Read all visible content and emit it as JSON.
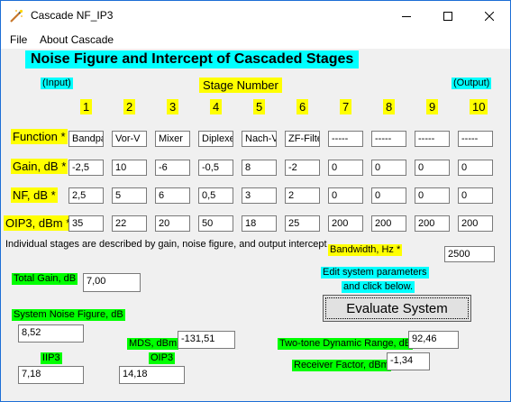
{
  "window": {
    "title": "Cascade NF_IP3"
  },
  "menu": {
    "file": "File",
    "about": "About Cascade"
  },
  "heading": "Noise Figure and Intercept of Cascaded Stages",
  "labels": {
    "input": "(Input)",
    "output": "(Output)",
    "stage_number": "Stage Number",
    "function": "Function *",
    "gain": "Gain, dB *",
    "nf": "NF, dB *",
    "oip3": "OIP3, dBm *",
    "description": "Individual stages are described by gain, noise figure, and output intercept .",
    "bandwidth": "Bandwidth, Hz *",
    "edit_line1": "Edit system parameters",
    "edit_line2": "and click below.",
    "total_gain": "Total Gain, dB",
    "system_nf": "System Noise Figure, dB",
    "mds": "MDS, dBm",
    "iip3": "IIP3",
    "oip3_result": "OIP3",
    "two_tone": "Two-tone Dynamic Range, dB",
    "receiver_factor": "Receiver Factor, dBm"
  },
  "stages": [
    "1",
    "2",
    "3",
    "4",
    "5",
    "6",
    "7",
    "8",
    "9",
    "10"
  ],
  "functions": [
    "Bandpa",
    "Vor-V",
    "Mixer",
    "Diplexer",
    "Nach-V",
    "ZF-Filte",
    "-----",
    "-----",
    "-----",
    "-----"
  ],
  "gains": [
    "-2,5",
    "10",
    "-6",
    "-0,5",
    "8",
    "-2",
    "0",
    "0",
    "0",
    "0"
  ],
  "nfs": [
    "2,5",
    "5",
    "6",
    "0,5",
    "3",
    "2",
    "0",
    "0",
    "0",
    "0"
  ],
  "oip3s": [
    "35",
    "22",
    "20",
    "50",
    "18",
    "25",
    "200",
    "200",
    "200",
    "200"
  ],
  "bandwidth_value": "2500",
  "evaluate_button": "Evaluate System",
  "results": {
    "total_gain": "7,00",
    "system_nf": "8,52",
    "mds": "-131,51",
    "iip3": "7,18",
    "oip3": "14,18",
    "two_tone": "92,46",
    "receiver_factor": "-1,34"
  },
  "icons": {
    "app": "wand-icon",
    "minimize": "minimize-icon",
    "maximize": "maximize-icon",
    "close": "close-icon"
  },
  "colors": {
    "cyan": "#00ffff",
    "yellow": "#ffff00",
    "green": "#00ff00",
    "border": "#1c6ed6"
  }
}
